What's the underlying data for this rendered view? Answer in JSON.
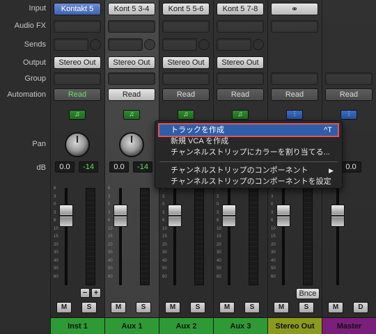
{
  "row_labels": {
    "input": "Input",
    "audio_fx": "Audio FX",
    "sends": "Sends",
    "output": "Output",
    "group": "Group",
    "automation": "Automation",
    "pan": "Pan",
    "db": "dB"
  },
  "scale_marks": [
    "6",
    "3",
    "0",
    "3",
    "6",
    "10",
    "15",
    "20",
    "30",
    "40",
    "50",
    "60"
  ],
  "strips": [
    {
      "input": "Kontakt 5",
      "output": "Stereo Out",
      "automation": "Read",
      "vol": "0.0",
      "peak": "-14",
      "m": "M",
      "s": "S",
      "name": "Inst 1",
      "minus": "−",
      "plus": "+"
    },
    {
      "input": "Kont 5 3-4",
      "output": "Stereo Out",
      "automation": "Read",
      "vol": "0.0",
      "peak": "-14",
      "m": "M",
      "s": "S",
      "name": "Aux 1"
    },
    {
      "input": "Kont 5 5-6",
      "output": "Stereo Out",
      "automation": "Read",
      "m": "M",
      "s": "S",
      "name": "Aux 2"
    },
    {
      "input": "Kont 5 7-8",
      "output": "Stereo Out",
      "automation": "Read",
      "m": "M",
      "s": "S",
      "name": "Aux 3"
    },
    {
      "input_icon": "link-rings-icon",
      "automation": "Read",
      "bnce": "Bnce",
      "m": "M",
      "s": "S",
      "name": "Stereo Out"
    },
    {
      "automation": "Read",
      "vol": "0.0",
      "m": "M",
      "d": "D",
      "name": "Master"
    }
  ],
  "context_menu": {
    "items": [
      {
        "label": "トラックを作成",
        "shortcut": "^T"
      },
      {
        "label": "新規 VCA を作成"
      },
      {
        "label": "チャンネルストリップにカラーを割り当てる..."
      },
      {
        "label": "チャンネルストリップのコンポーネント",
        "arrow": "▶"
      },
      {
        "label": "チャンネルストリップのコンポーネントを設定"
      }
    ]
  },
  "colors": {
    "inst_aux_name_bg": "#2f9a35",
    "stereo_out_name_bg": "#8a9a1e",
    "master_name_bg": "#7a1f7a",
    "highlight": "#2f5ea8",
    "highlight_border": "#e8525b"
  }
}
